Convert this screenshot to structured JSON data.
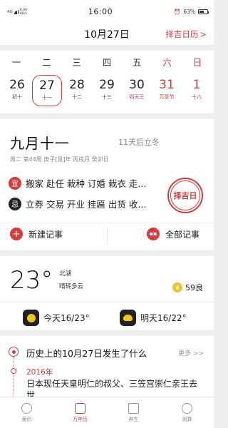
{
  "status_bar": {
    "network": "4G",
    "speed": "0.00",
    "speed_unit": "KB/s",
    "time": "16:00",
    "battery_text": "63%",
    "battery_level": 0.63
  },
  "header": {
    "date": "10月27日",
    "zeji_link": "择吉日历",
    "zeji_arrow": ">"
  },
  "week": {
    "headers": [
      "一",
      "二",
      "三",
      "四",
      "五",
      "六",
      "日"
    ],
    "days": [
      {
        "num": "26",
        "lunar": "初十"
      },
      {
        "num": "27",
        "lunar": "十一"
      },
      {
        "num": "28",
        "lunar": "十二"
      },
      {
        "num": "29",
        "lunar": "十三"
      },
      {
        "num": "30",
        "lunar": "四天王"
      },
      {
        "num": "31",
        "lunar": "万圣节"
      },
      {
        "num": "1",
        "lunar": "十六"
      }
    ]
  },
  "info": {
    "lunar_date": "九月十一",
    "countdown": "11天后立冬",
    "ganzhi": "周二 第44周  庚子[鼠]年 丙戌月 癸卯日",
    "yi_label": "宜",
    "yi_text": "搬家 赴任 栽种 订婚 栽衣 走...",
    "ji_label": "忌",
    "ji_text": "立券 交易 开业 挂匾 出货 收...",
    "stamp": "择吉日",
    "new_note": "新建记事",
    "all_notes": "全部记事",
    "plus_icon": "+"
  },
  "weather": {
    "temp": "23°",
    "city": "北湖",
    "condition": "晴转多云",
    "aqi": "59良",
    "today": "今天16/23°",
    "tomorrow": "明天16/22°"
  },
  "history": {
    "title": "历史上的10月27日发生了什么",
    "more": "更多 >>",
    "year": "2016年",
    "event": "日本现任天皇明仁的叔父、三笠宫崇仁亲王去世"
  },
  "tabs": [
    "黄历",
    "万年历",
    "养生",
    "测算"
  ]
}
